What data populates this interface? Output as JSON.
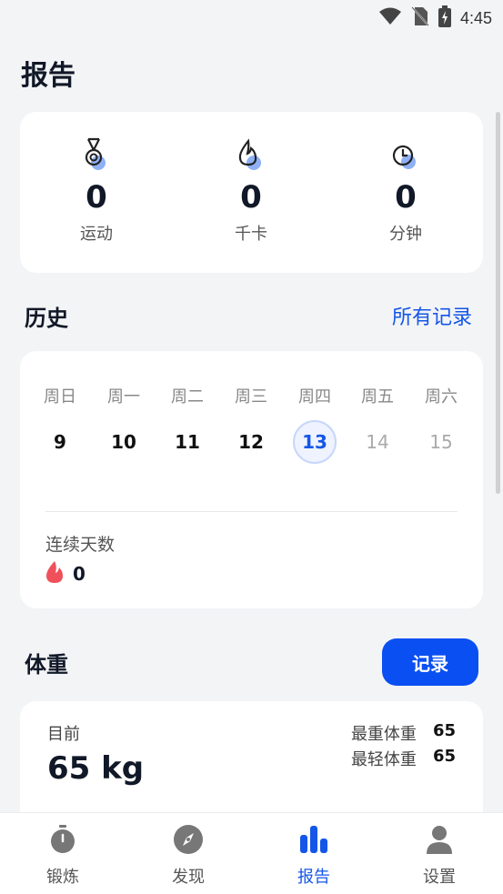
{
  "status_bar": {
    "time": "4:45"
  },
  "page": {
    "title": "报告"
  },
  "summary": [
    {
      "icon": "medal-icon",
      "value": "0",
      "label": "运动"
    },
    {
      "icon": "flame-icon",
      "value": "0",
      "label": "千卡"
    },
    {
      "icon": "clock-icon",
      "value": "0",
      "label": "分钟"
    }
  ],
  "history": {
    "title": "历史",
    "all_records_link": "所有记录",
    "days": [
      {
        "name": "周日",
        "num": "9",
        "state": "past"
      },
      {
        "name": "周一",
        "num": "10",
        "state": "past"
      },
      {
        "name": "周二",
        "num": "11",
        "state": "past"
      },
      {
        "name": "周三",
        "num": "12",
        "state": "past"
      },
      {
        "name": "周四",
        "num": "13",
        "state": "today"
      },
      {
        "name": "周五",
        "num": "14",
        "state": "future"
      },
      {
        "name": "周六",
        "num": "15",
        "state": "future"
      }
    ],
    "streak_label": "连续天数",
    "streak_value": "0"
  },
  "weight": {
    "title": "体重",
    "record_button": "记录",
    "current_label": "目前",
    "current_value": "65 kg",
    "heaviest_label": "最重体重",
    "heaviest_value": "65",
    "lightest_label": "最轻体重",
    "lightest_value": "65"
  },
  "tabs": [
    {
      "icon": "stopwatch-icon",
      "label": "锻炼",
      "active": false
    },
    {
      "icon": "compass-icon",
      "label": "发现",
      "active": false
    },
    {
      "icon": "bar-chart-icon",
      "label": "报告",
      "active": true
    },
    {
      "icon": "person-icon",
      "label": "设置",
      "active": false
    }
  ],
  "colors": {
    "accent": "#1456e8",
    "button": "#0a4ff2",
    "flame": "#f0505a",
    "background": "#f3f4f6"
  }
}
